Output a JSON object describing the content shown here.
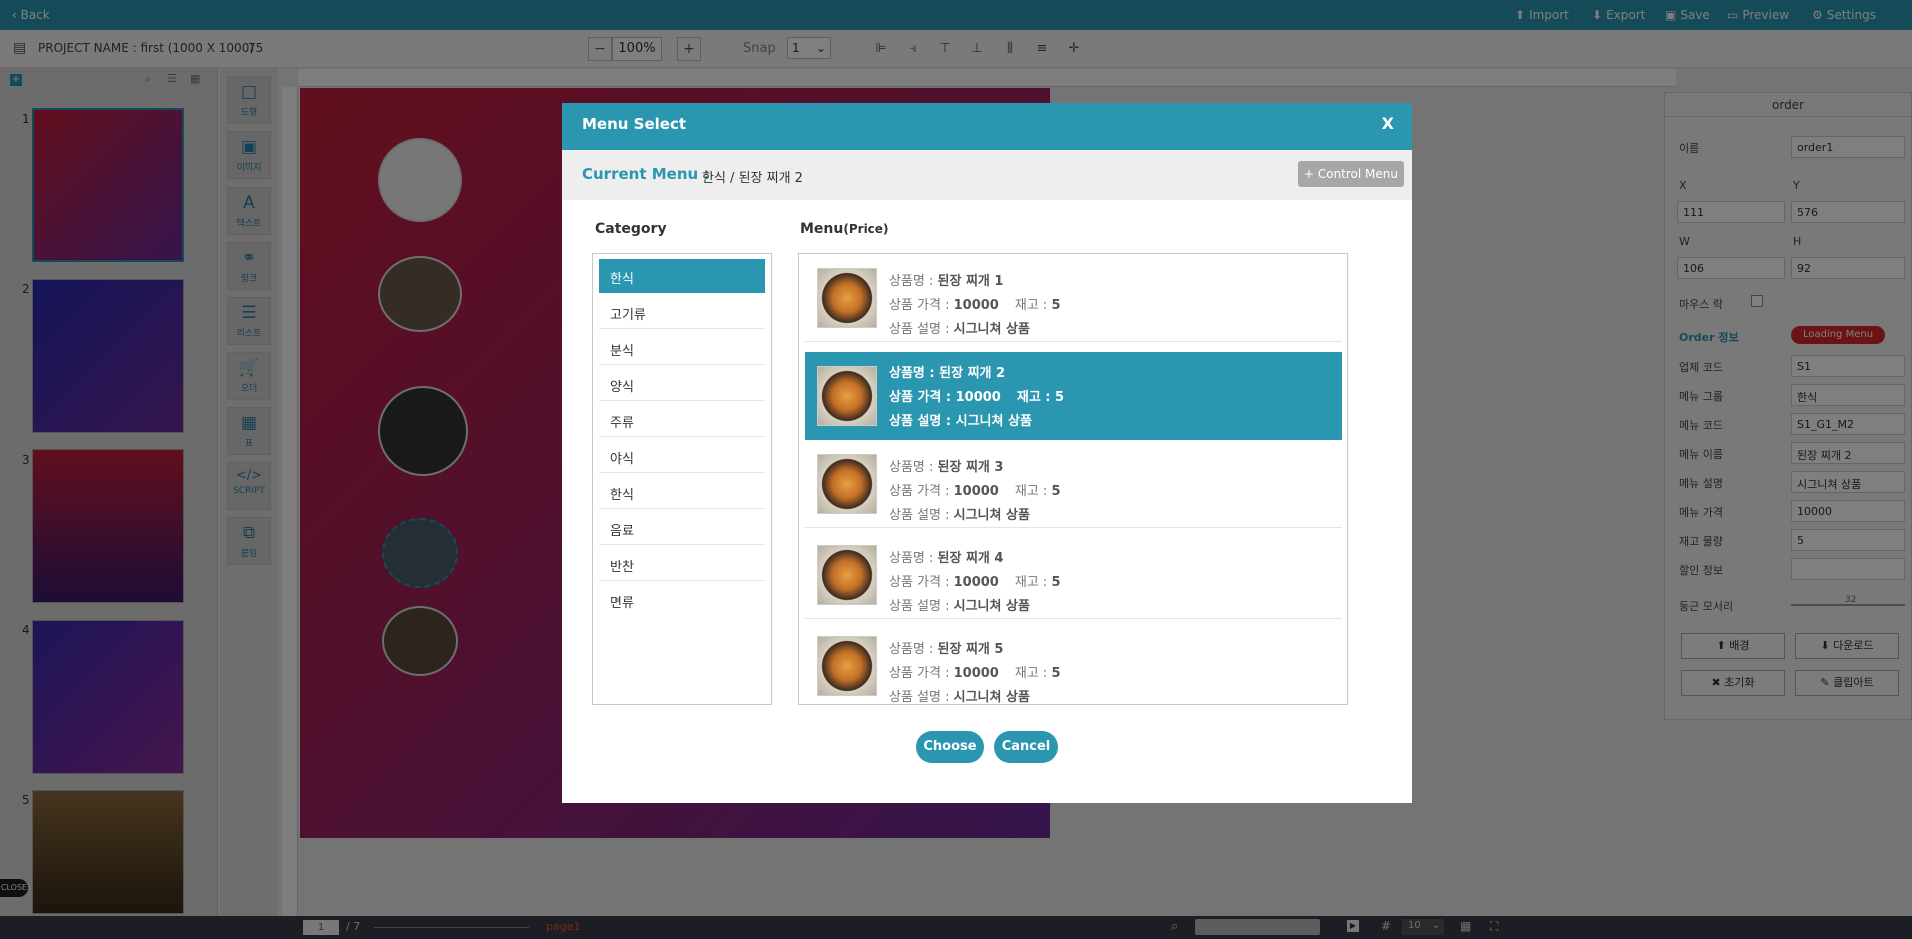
{
  "topbar": {
    "back": "Back",
    "import": "Import",
    "export": "Export",
    "save": "Save",
    "preview": "Preview",
    "settings": "Settings"
  },
  "project": {
    "name_label": "PROJECT NAME : first (1000 X 1000)",
    "extra": "75",
    "zoom": "100%",
    "snap_label": "Snap",
    "snap_value": "1"
  },
  "pages": [
    "1",
    "2",
    "3",
    "4",
    "5"
  ],
  "close_tab": "CLOSE",
  "tools": [
    {
      "icon": "□",
      "label": "도형"
    },
    {
      "icon": "▣",
      "label": "이미지"
    },
    {
      "icon": "A",
      "label": "텍스트"
    },
    {
      "icon": "⚭",
      "label": "링크"
    },
    {
      "icon": "☰",
      "label": "리스트"
    },
    {
      "icon": "🛒",
      "label": "오더"
    },
    {
      "icon": "▦",
      "label": "표"
    },
    {
      "icon": "</>",
      "label": "SCRIPT"
    },
    {
      "icon": "⧉",
      "label": "붙임"
    }
  ],
  "right_panel": {
    "title": "order",
    "name_label": "이름",
    "name_value": "order1",
    "x_label": "X",
    "y_label": "Y",
    "x_value": "111",
    "y_value": "576",
    "w_label": "W",
    "h_label": "H",
    "w_value": "106",
    "h_value": "92",
    "mouse_lock": "마우스 락",
    "order_info": "Order 정보",
    "loading_menu": "Loading Menu",
    "fields": [
      {
        "label": "업체 코드",
        "value": "S1"
      },
      {
        "label": "메뉴 그룹",
        "value": "한식"
      },
      {
        "label": "메뉴 코드",
        "value": "S1_G1_M2"
      },
      {
        "label": "메뉴 이름",
        "value": "된장 찌개 2"
      },
      {
        "label": "메뉴 설명",
        "value": "시그니쳐 상품"
      },
      {
        "label": "메뉴 가격",
        "value": "10000"
      },
      {
        "label": "재고 물량",
        "value": "5"
      },
      {
        "label": "할인 정보",
        "value": ""
      }
    ],
    "round_corner": "둥근 모서리",
    "round_value": "32",
    "btn_bg": "배경",
    "btn_download": "다운로드",
    "btn_reset": "초기화",
    "btn_clipart": "클립아트"
  },
  "bottombar": {
    "page_input": "1",
    "page_total": "/ 7",
    "page_name": "page1",
    "grid_value": "10"
  },
  "modal": {
    "title": "Menu Select",
    "close": "X",
    "current_label": "Current Menu :",
    "current_value": "한식 / 된장 찌개 2",
    "control_menu": "+ Control Menu",
    "category_title": "Category",
    "menu_title": "Menu",
    "menu_title_sub": "(Price)",
    "categories": [
      "한식",
      "고기류",
      "분식",
      "양식",
      "주류",
      "야식",
      "한식",
      "음료",
      "반찬",
      "면류"
    ],
    "selected_category": 0,
    "items": [
      {
        "name_label": "상품명 : ",
        "name": "된장 찌개 1",
        "price_label": "상품 가격  : ",
        "price": "10000",
        "stock_label": "재고 : ",
        "stock": "5",
        "desc_label": "상품 설명 : ",
        "desc": "시그니쳐 상품"
      },
      {
        "name_label": "상품명 : ",
        "name": "된장 찌개 2",
        "price_label": "상품 가격  : ",
        "price": "10000",
        "stock_label": "재고 : ",
        "stock": "5",
        "desc_label": "상품 설명 : ",
        "desc": "시그니쳐 상품"
      },
      {
        "name_label": "상품명 : ",
        "name": "된장 찌개 3",
        "price_label": "상품 가격  : ",
        "price": "10000",
        "stock_label": "재고 : ",
        "stock": "5",
        "desc_label": "상품 설명 : ",
        "desc": "시그니쳐 상품"
      },
      {
        "name_label": "상품명 : ",
        "name": "된장 찌개 4",
        "price_label": "상품 가격  : ",
        "price": "10000",
        "stock_label": "재고 : ",
        "stock": "5",
        "desc_label": "상품 설명 : ",
        "desc": "시그니쳐 상품"
      },
      {
        "name_label": "상품명 : ",
        "name": "된장 찌개 5",
        "price_label": "상품 가격  : ",
        "price": "10000",
        "stock_label": "재고 : ",
        "stock": "5",
        "desc_label": "상품 설명 : ",
        "desc": "시그니쳐 상품"
      }
    ],
    "selected_item": 1,
    "choose": "Choose",
    "cancel": "Cancel"
  },
  "colors": {
    "accent": "#2a96b0",
    "loading_badge": "#d9262b"
  }
}
